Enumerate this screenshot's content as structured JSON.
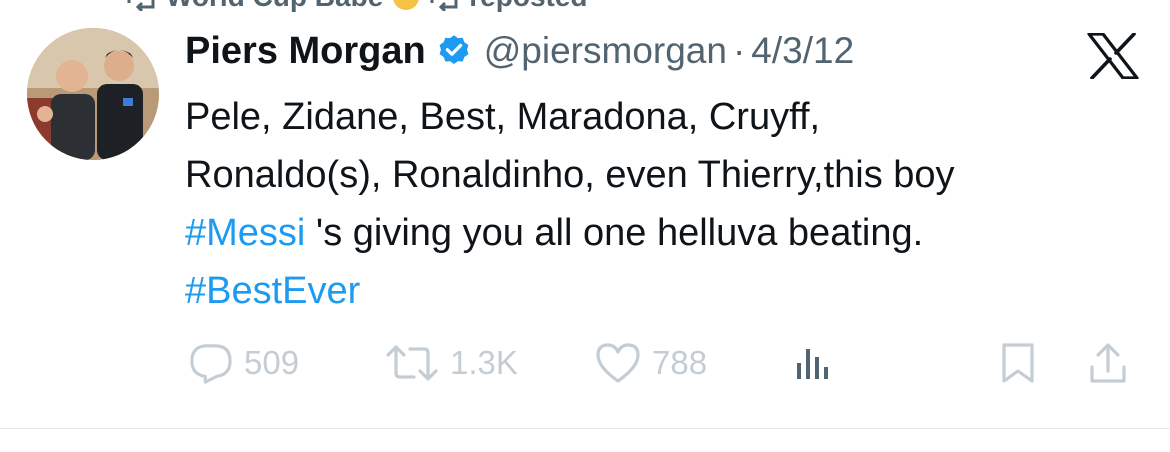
{
  "repost": {
    "text": "World Cup Babe",
    "suffix": "reposted",
    "emoji_icon": "crown-emoji-icon",
    "icon": "repost-icon"
  },
  "tweet": {
    "display_name": "Piers Morgan",
    "verified": true,
    "handle": "@piersmorgan",
    "separator": "·",
    "date": "4/3/12",
    "body": {
      "line1": "Pele, Zidane, Best, Maradona, Cruyff,",
      "line2": "Ronaldo(s), Ronaldinho, even Thierry,this boy",
      "line3_tag": "#Messi",
      "line3_rest": " 's giving you all one helluva beating.",
      "line4_tag": "#BestEver"
    }
  },
  "actions": {
    "replies": "509",
    "reposts": "1.3K",
    "likes": "788"
  },
  "colors": {
    "accent": "#1d9bf0",
    "text": "#0f1419",
    "muted": "#536471",
    "icon_muted": "#c4cdd3"
  }
}
